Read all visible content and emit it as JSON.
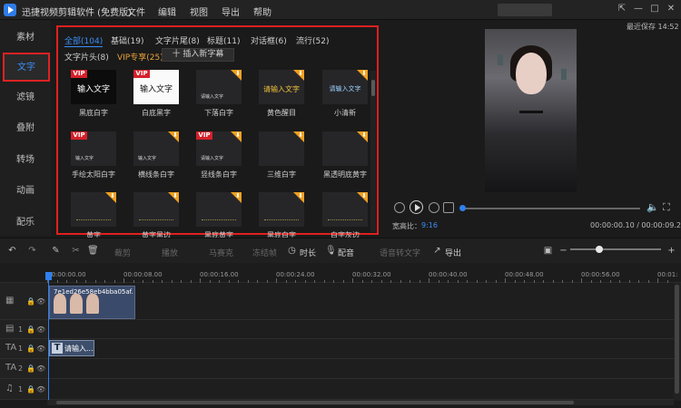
{
  "titlebar": {
    "app_title": "迅捷视频剪辑软件 (免费版)",
    "menu": [
      "文件",
      "编辑",
      "视图",
      "导出",
      "帮助"
    ],
    "window_controls": [
      "⇱",
      "—",
      "□",
      "✕"
    ]
  },
  "sidebar": {
    "items": [
      {
        "label": "素材",
        "active": false
      },
      {
        "label": "文字",
        "active": true
      },
      {
        "label": "滤镜",
        "active": false
      },
      {
        "label": "叠附",
        "active": false
      },
      {
        "label": "转场",
        "active": false
      },
      {
        "label": "动画",
        "active": false
      },
      {
        "label": "配乐",
        "active": false
      }
    ]
  },
  "text_panel": {
    "categories_row1": [
      {
        "label": "全部(104)",
        "active": true
      },
      {
        "label": "基础(19)"
      },
      {
        "label": "文字片尾(8)"
      },
      {
        "label": "标题(11)"
      },
      {
        "label": "对话框(6)"
      },
      {
        "label": "流行(52)"
      }
    ],
    "categories_row2": [
      {
        "label": "文字片头(8)"
      },
      {
        "label": "VIP专享(25)",
        "vip": true
      }
    ],
    "insert_button": "十 插入新字幕",
    "vip_badge": "VIP",
    "download_glyph": "⬇",
    "templates": [
      {
        "label": "黑底白字",
        "preview": "输入文字",
        "style": "black",
        "vip": true
      },
      {
        "label": "白底黑字",
        "preview": "输入文字",
        "style": "white",
        "vip": true
      },
      {
        "label": "下落白字",
        "preview": "请输入文字",
        "style": "small",
        "download": true
      },
      {
        "label": "黄色醒目",
        "preview": "请输入文字",
        "style": "yellow",
        "download": true
      },
      {
        "label": "小清新",
        "preview": "请输入文字",
        "style": "fresh",
        "download": true
      },
      {
        "label": "手绘太阳白字",
        "preview": "输入文字",
        "style": "small",
        "vip": true
      },
      {
        "label": "横线条白字",
        "preview": "输入文字",
        "style": "small",
        "download": true
      },
      {
        "label": "竖线条白字",
        "preview": "请输入文字",
        "style": "small",
        "vip": true,
        "download": true
      },
      {
        "label": "三维白字",
        "preview": "",
        "style": "plain",
        "download": true
      },
      {
        "label": "黑透明底黄字",
        "preview": "",
        "style": "plain",
        "download": true
      },
      {
        "label": "黄字",
        "preview": "",
        "style": "line",
        "download": true
      },
      {
        "label": "黄字黑边",
        "preview": "",
        "style": "line",
        "download": true
      },
      {
        "label": "黑底黄字",
        "preview": "",
        "style": "line",
        "download": true
      },
      {
        "label": "黑底白字",
        "preview": "",
        "style": "line",
        "download": true
      },
      {
        "label": "白字灰边",
        "preview": "",
        "style": "line",
        "download": true
      }
    ]
  },
  "preview": {
    "save_info": "最近保存 14:52",
    "ratio_label": "宽高比：",
    "ratio_value": "9:16",
    "time": "00:00:00.10 / 00:00:09.26",
    "progress": 0.0
  },
  "toolbar": {
    "undo": "↶",
    "redo": "↷",
    "edit": "✎",
    "delete": "🗑",
    "crop": "裁剪",
    "playback": "播放",
    "mosaic": "马赛克",
    "freeze": "冻结帧",
    "duration": "时长",
    "dubbing": "配音",
    "tts": "语音转文字",
    "export": "导出",
    "zoom_minus": "−",
    "zoom_plus": "+",
    "zoom_level": 0.28
  },
  "ruler": {
    "labels": [
      "00:00:00.00",
      "00:00:08.00",
      "00:00:16.00",
      "00:00:24.00",
      "00:00:32.00",
      "00:00:40.00",
      "00:00:48.00",
      "00:00:56.00",
      "00:01:"
    ]
  },
  "tracks": [
    {
      "icon": "▦",
      "num": ""
    },
    {
      "icon": "▤",
      "num": "1"
    },
    {
      "icon": "TA",
      "num": "1"
    },
    {
      "icon": "TA",
      "num": "2"
    },
    {
      "icon": "♫",
      "num": "1"
    }
  ],
  "clips": {
    "video_name": "7e1ed26e58eb4bba05af...",
    "text_name": "请输入...",
    "text_icon": "T"
  }
}
